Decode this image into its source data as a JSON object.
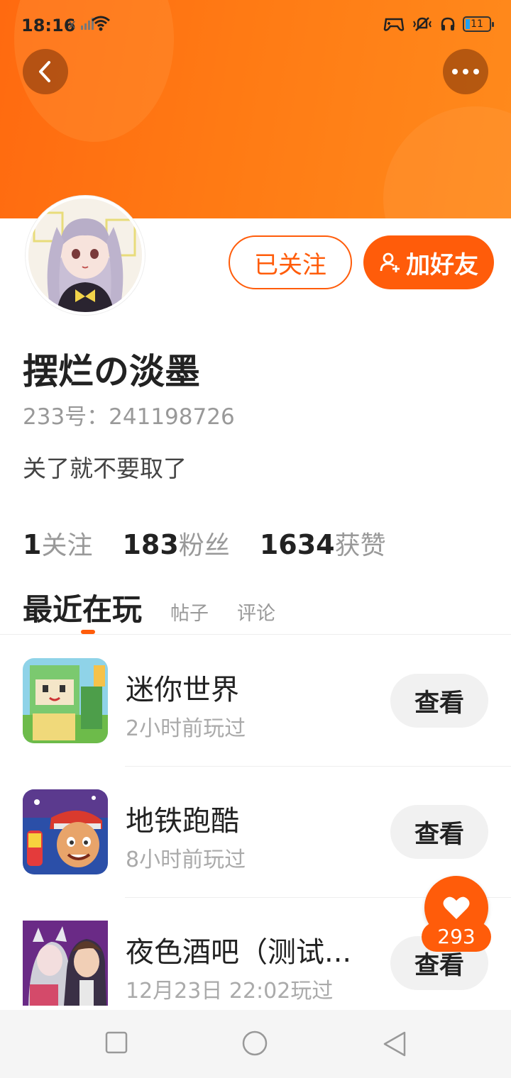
{
  "status_bar": {
    "time": "18:16",
    "battery": "11",
    "sim_indicator": "x",
    "icons": [
      "signal-icon",
      "wifi-icon",
      "game-icon",
      "vibrate-icon",
      "headset-icon",
      "battery-icon"
    ]
  },
  "header": {
    "back_icon": "chevron-left-icon",
    "more_icon": "more-dots-icon",
    "bg_color": "#ff7014"
  },
  "profile": {
    "username": "摆烂の淡墨",
    "id_text": "233号：241198726",
    "bio": "关了就不要取了",
    "followed_label": "已关注",
    "add_friend_label": "加好友",
    "add_friend_icon": "add-person-icon"
  },
  "stats": [
    {
      "num": "1",
      "label": "关注"
    },
    {
      "num": "183",
      "label": "粉丝"
    },
    {
      "num": "1634",
      "label": "获赞"
    }
  ],
  "tabs": [
    {
      "label": "最近在玩",
      "active": true
    },
    {
      "label": "帖子",
      "active": false
    },
    {
      "label": "评论",
      "active": false
    }
  ],
  "games": [
    {
      "title": "迷你世界",
      "time": "2小时前玩过",
      "button": "查看"
    },
    {
      "title": "地铁跑酷",
      "time": "8小时前玩过",
      "button": "查看"
    },
    {
      "title": "夜色酒吧（测试...",
      "time": "12月23日 22:02玩过",
      "button": "查看"
    }
  ],
  "like": {
    "icon": "heart-icon",
    "count": "293"
  },
  "colors": {
    "accent": "#ff5c0a",
    "muted": "#999999"
  },
  "nav_bar": {
    "icons": [
      "square-icon",
      "circle-icon",
      "back-triangle-icon"
    ]
  }
}
